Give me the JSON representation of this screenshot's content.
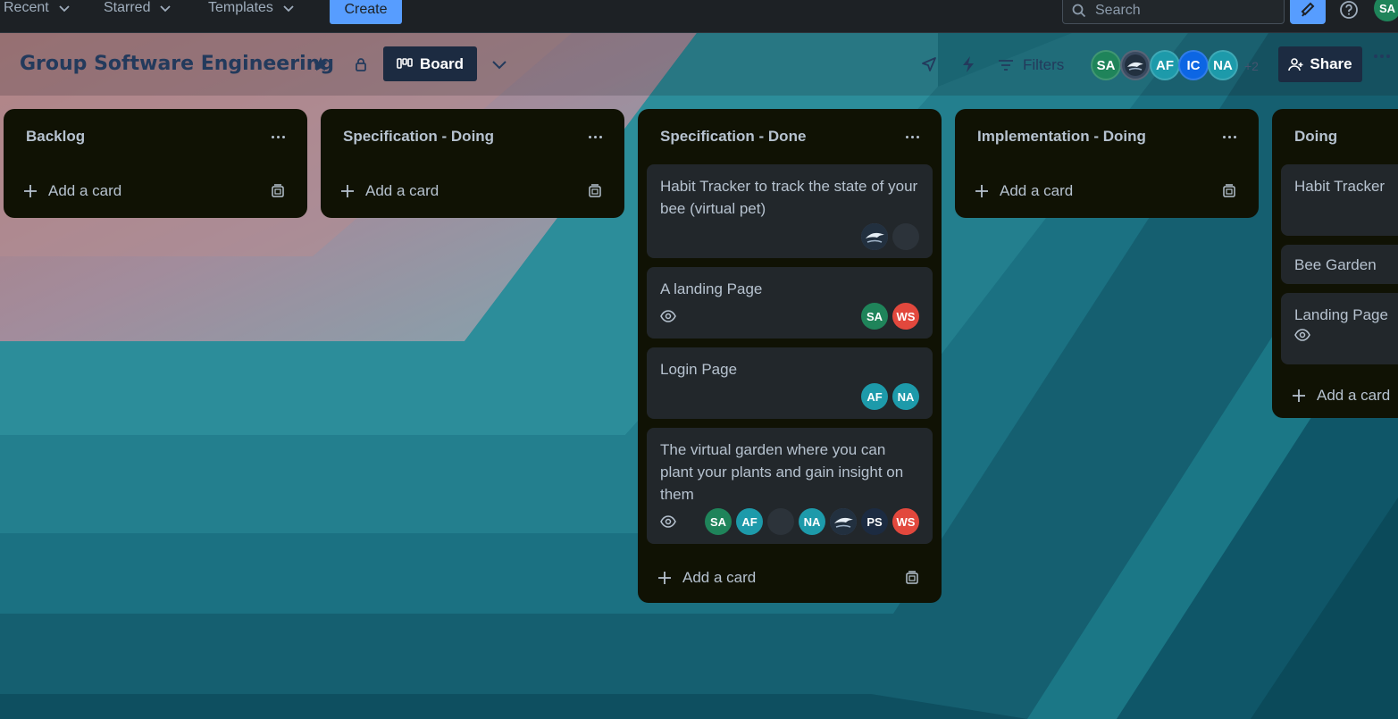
{
  "topbar": {
    "nav": [
      {
        "label": "Recent"
      },
      {
        "label": "Starred"
      },
      {
        "label": "Templates"
      }
    ],
    "create_label": "Create",
    "search_placeholder": "Search",
    "me_initials": "SA",
    "colors": {
      "accent": "#579dff",
      "bar_bg": "#1d2125"
    }
  },
  "board": {
    "title": "Group Software Engineering",
    "view_label": "Board",
    "filters_label": "Filters",
    "members": [
      {
        "initials": "SA",
        "color": "#1f845a"
      },
      {
        "initials": "",
        "color": "#3a4a60",
        "photo": true
      },
      {
        "initials": "AF",
        "color": "#1d9aaa"
      },
      {
        "initials": "IC",
        "color": "#0c66e4"
      },
      {
        "initials": "NA",
        "color": "#1d9aaa"
      }
    ],
    "more_members": "+2",
    "share_label": "Share"
  },
  "lists": [
    {
      "title": "Backlog",
      "add_label": "Add a card",
      "cards": []
    },
    {
      "title": "Specification - Doing",
      "add_label": "Add a card",
      "cards": []
    },
    {
      "title": "Specification - Done",
      "add_label": "Add a card",
      "cards": [
        {
          "title": "Habit Tracker to track the state of your bee (virtual pet)",
          "watch": false,
          "avatars": [
            {
              "initials": "",
              "kind": "photo"
            },
            {
              "initials": "",
              "kind": "dark"
            }
          ]
        },
        {
          "title": "A landing Page",
          "watch": true,
          "avatars": [
            {
              "initials": "SA",
              "color": "#1f845a"
            },
            {
              "initials": "WS",
              "color": "#e2483d"
            }
          ]
        },
        {
          "title": "Login Page",
          "watch": false,
          "avatars": [
            {
              "initials": "AF",
              "color": "#1d9aaa"
            },
            {
              "initials": "NA",
              "color": "#1d9aaa"
            }
          ]
        },
        {
          "title": "The virtual garden where you can plant your plants and gain insight on them",
          "watch": true,
          "avatars": [
            {
              "initials": "SA",
              "color": "#1f845a"
            },
            {
              "initials": "AF",
              "color": "#1d9aaa"
            },
            {
              "initials": "",
              "kind": "dark"
            },
            {
              "initials": "NA",
              "color": "#1d9aaa"
            },
            {
              "initials": "",
              "kind": "photo"
            },
            {
              "initials": "PS",
              "color": "#1c2b41"
            },
            {
              "initials": "WS",
              "color": "#e2483d"
            }
          ]
        }
      ]
    },
    {
      "title": "Implementation - Doing",
      "add_label": "Add a card",
      "cards": []
    },
    {
      "title": "Doing",
      "add_label": "Add a card",
      "cards": [
        {
          "title": "Habit Tracker",
          "watch": false,
          "avatars": [],
          "tall": true
        },
        {
          "title": "Bee Garden",
          "watch": false,
          "avatars": []
        },
        {
          "title": "Landing Page",
          "watch": true,
          "avatars": []
        }
      ]
    }
  ]
}
